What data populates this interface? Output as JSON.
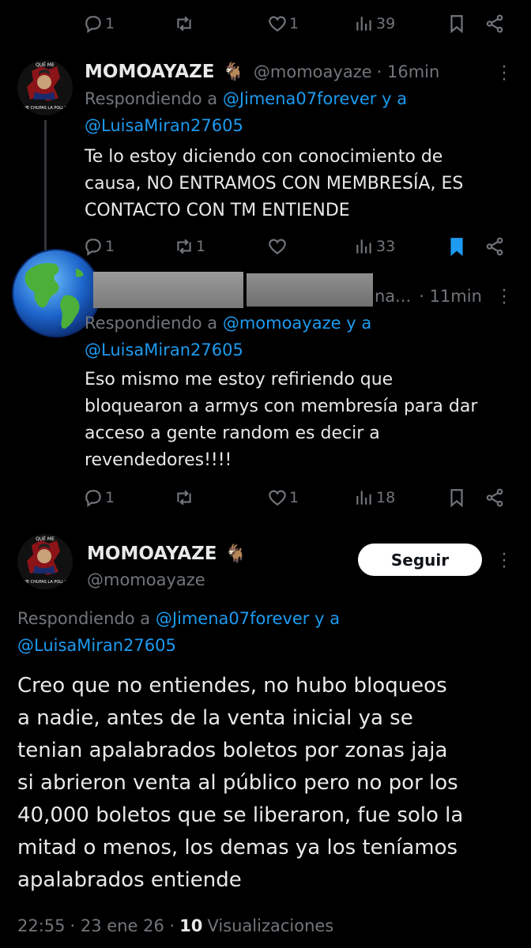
{
  "top_actions": {
    "replies": "1",
    "retweets": "",
    "likes": "1",
    "views": "39"
  },
  "tweet1": {
    "name": "MOMOAYAZE",
    "handle": "@momoayaze",
    "time": "· 16min",
    "replying_prefix": "Respondiendo a",
    "replying_user1": "@Jimena07forever",
    "replying_conj": "y a",
    "replying_user2": "@LuisaMiran27605",
    "text_lines": [
      "Te lo estoy diciendo con conocimiento de",
      "causa, NO ENTRAMOS CON MEMBRESÍA, ES",
      "CONTACTO CON TM ENTIENDE"
    ],
    "actions": {
      "replies": "1",
      "retweets": "1",
      "likes": "",
      "views": "33"
    },
    "avatar_text_top": "QUÉ ME",
    "avatar_text_bottom": "ME CHUPAS LA POLLA"
  },
  "tweet2": {
    "name_partial": "na...",
    "time": "· 11min",
    "replying_prefix": "Respondiendo a",
    "replying_user1": "@momoayaze",
    "replying_conj": "y a",
    "replying_user2": "@LuisaMiran27605",
    "text_lines": [
      "Eso mismo me estoy refiriendo que",
      "bloquearon a armys con membresía para dar",
      "acceso a gente random es decir a",
      "revendedores!!!!"
    ],
    "actions": {
      "replies": "1",
      "retweets": "",
      "likes": "1",
      "views": "18"
    }
  },
  "main_tweet": {
    "name": "MOMOAYAZE",
    "handle": "@momoayaze",
    "follow_label": "Seguir",
    "replying_prefix": "Respondiendo a",
    "replying_user1": "@Jimena07forever",
    "replying_conj": "y a",
    "replying_user2": "@LuisaMiran27605",
    "text_lines": [
      "Creo que no entiendes, no hubo bloqueos",
      "a nadie, antes de la venta inicial ya se",
      "tenian apalabrados boletos por zonas jaja",
      "si abrieron venta al público pero no por los",
      "40,000 boletos que se liberaron, fue solo la",
      "mitad o menos, los demas ya los teníamos",
      "apalabrados entiende"
    ],
    "time": "22:55",
    "date": "· 23 ene 26 ·",
    "views_count": "10",
    "views_label": "Visualizaciones"
  },
  "colors": {
    "background": "#000000",
    "text": "#e7e9ea",
    "muted": "#71767b",
    "link": "#1d9bf0",
    "bookmark_active": "#1d9bf0"
  }
}
